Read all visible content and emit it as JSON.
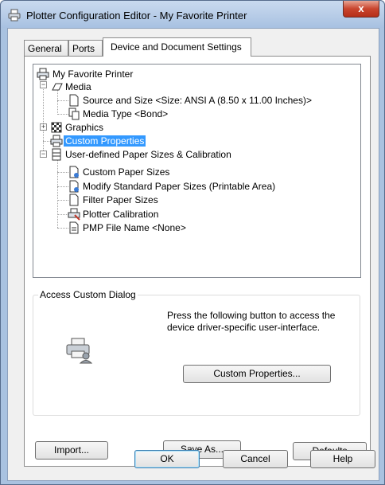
{
  "window": {
    "title": "Plotter Configuration Editor - My Favorite Printer",
    "close_label": "x"
  },
  "tabs": [
    {
      "label": "General"
    },
    {
      "label": "Ports"
    },
    {
      "label": "Device and Document Settings"
    }
  ],
  "tree": {
    "root": "My Favorite Printer",
    "media": "Media",
    "source_size": "Source and Size <Size: ANSI A (8.50 x 11.00 Inches)>",
    "media_type": "Media Type <Bond>",
    "graphics": "Graphics",
    "custom_properties": "Custom Properties",
    "user_defined": "User-defined Paper Sizes & Calibration",
    "custom_paper": "Custom Paper Sizes",
    "modify_standard": "Modify Standard Paper Sizes (Printable Area)",
    "filter_paper": "Filter Paper Sizes",
    "plotter_calibration": "Plotter Calibration",
    "pmp_file": "PMP File Name <None>"
  },
  "access_group": {
    "legend": "Access Custom Dialog",
    "description": "Press the following button to access the device driver-specific user-interface.",
    "button": "Custom Properties..."
  },
  "buttons": {
    "import": "Import...",
    "save_as": "Save As...",
    "defaults": "Defaults",
    "ok": "OK",
    "cancel": "Cancel",
    "help": "Help"
  },
  "colors": {
    "selection": "#3399ff",
    "title_bar": "#b9cfeb",
    "close_button": "#c9452e"
  }
}
